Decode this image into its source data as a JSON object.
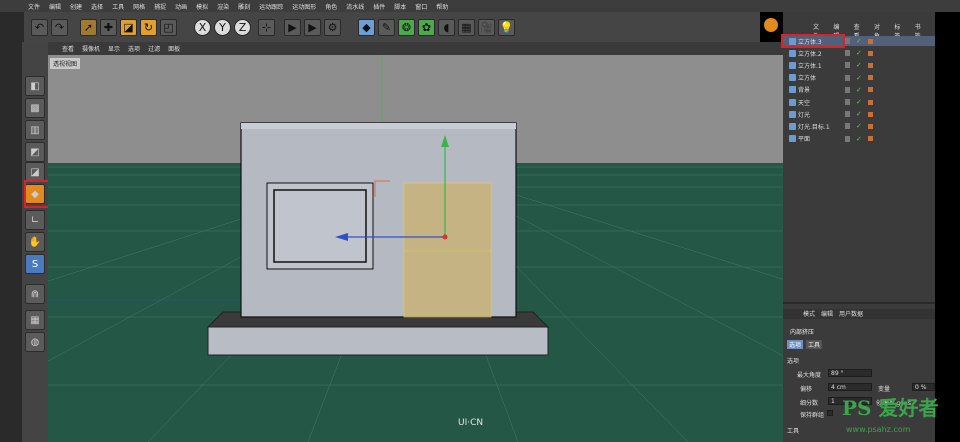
{
  "menu": [
    "文件",
    "编辑",
    "创建",
    "选择",
    "工具",
    "网格",
    "捕捉",
    "动画",
    "模拟",
    "渲染",
    "雕刻",
    "运动跟踪",
    "运动图形",
    "角色",
    "流水线",
    "插件",
    "脚本",
    "窗口",
    "帮助"
  ],
  "viewport_menu": [
    "查看",
    "摄像机",
    "显示",
    "选项",
    "过滤",
    "面板"
  ],
  "viewport_label": "透视视图",
  "object_tabs": [
    "文件",
    "编辑",
    "查看",
    "对象",
    "标签",
    "书签"
  ],
  "objects": [
    {
      "name": "立方体.3",
      "selected": true
    },
    {
      "name": "立方体.2"
    },
    {
      "name": "立方体.1"
    },
    {
      "name": "立方体"
    },
    {
      "name": "背景"
    },
    {
      "name": "天空"
    },
    {
      "name": "灯光"
    },
    {
      "name": "灯光.目标.1"
    },
    {
      "name": "平面"
    }
  ],
  "attr_tabs": [
    "模式",
    "编辑",
    "用户数据"
  ],
  "attr_title": "内部挤压",
  "attr_subtabs": [
    "选项",
    "工具"
  ],
  "section_options": "选项",
  "fields": {
    "max_angle_label": "最大角度",
    "max_angle_value": "89 °",
    "offset_label": "偏移",
    "offset_value": "4 cm",
    "variance_label": "变量",
    "variance_value": "0 %",
    "subdiv_label": "细分数",
    "subdiv_value": "1",
    "create_ngons_label": "创建 N-gons",
    "keep_groups_label": "保持群组"
  },
  "section_tool": "工具",
  "watermark_brand": "PS 爱好者",
  "watermark_url": "www.psahz.com",
  "logo_text": "UI·CN",
  "colors": {
    "accent_red": "#d8232a",
    "grid_green": "#245746",
    "selection_yellow": "#c8b37a"
  }
}
